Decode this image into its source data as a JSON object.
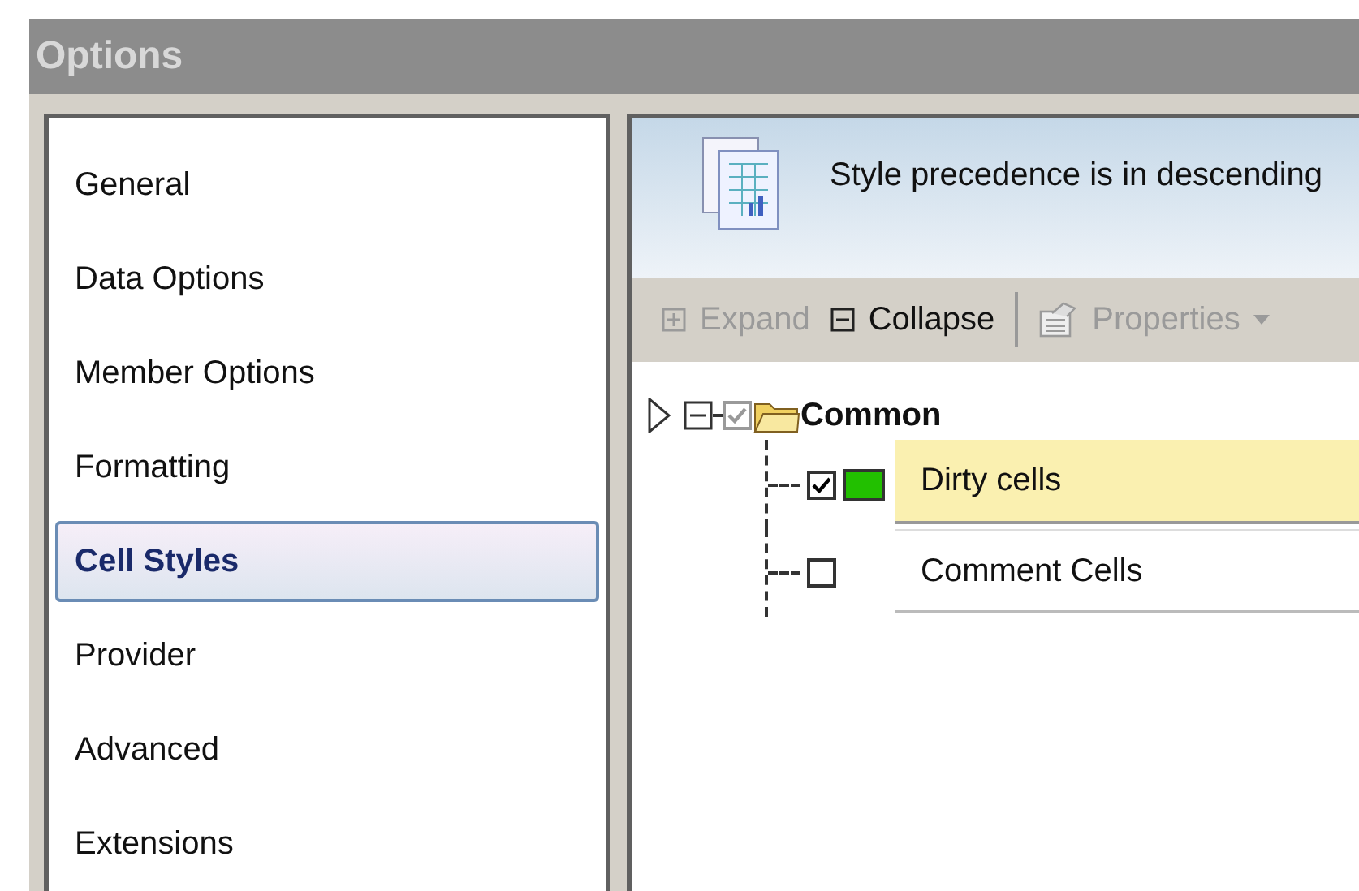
{
  "window": {
    "title": "Options"
  },
  "sidebar": {
    "items": [
      {
        "label": "General",
        "selected": false
      },
      {
        "label": "Data Options",
        "selected": false
      },
      {
        "label": "Member Options",
        "selected": false
      },
      {
        "label": "Formatting",
        "selected": false
      },
      {
        "label": "Cell Styles",
        "selected": true
      },
      {
        "label": "Provider",
        "selected": false
      },
      {
        "label": "Advanced",
        "selected": false
      },
      {
        "label": "Extensions",
        "selected": false
      }
    ]
  },
  "header": {
    "text": "Style precedence is in descending"
  },
  "toolbar": [
    {
      "kind": "expand",
      "label": "Expand",
      "disabled": true
    },
    {
      "kind": "collapse",
      "label": "Collapse",
      "disabled": false
    },
    {
      "kind": "properties",
      "label": "Properties",
      "disabled": true
    }
  ],
  "tree": {
    "label": "Common",
    "checked": true,
    "expanded": true,
    "children": [
      {
        "label": "Dirty cells",
        "checked": true,
        "selected": true,
        "color": "#22c000"
      },
      {
        "label": "Comment Cells",
        "checked": false,
        "selected": false
      }
    ]
  }
}
